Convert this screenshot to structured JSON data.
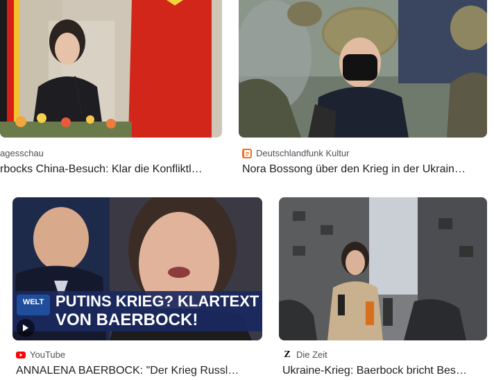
{
  "cards": [
    {
      "source": "agesschau",
      "title": "rbocks China-Besuch: Klar die Konfliktl…",
      "favicon": "tagesschau-icon"
    },
    {
      "source": "Deutschlandfunk Kultur",
      "title": "Nora Bossong über den Krieg in der Ukrain…",
      "favicon": "deutschlandfunk-icon",
      "favicon_color": "#f26b21"
    },
    {
      "source": "YouTube",
      "title": "ANNALENA BAERBOCK: \"Der Krieg Russl…",
      "favicon": "youtube-icon",
      "favicon_color": "#ff0000",
      "overlay_line1": "PUTINS KRIEG? KLARTEXT",
      "overlay_line2": "VON BAERBOCK!",
      "channel_logo": "WELT"
    },
    {
      "source": "Die Zeit",
      "title": "Ukraine-Krieg: Baerbock bricht Bes…",
      "favicon": "zeit-icon",
      "favicon_glyph": "Z"
    }
  ]
}
